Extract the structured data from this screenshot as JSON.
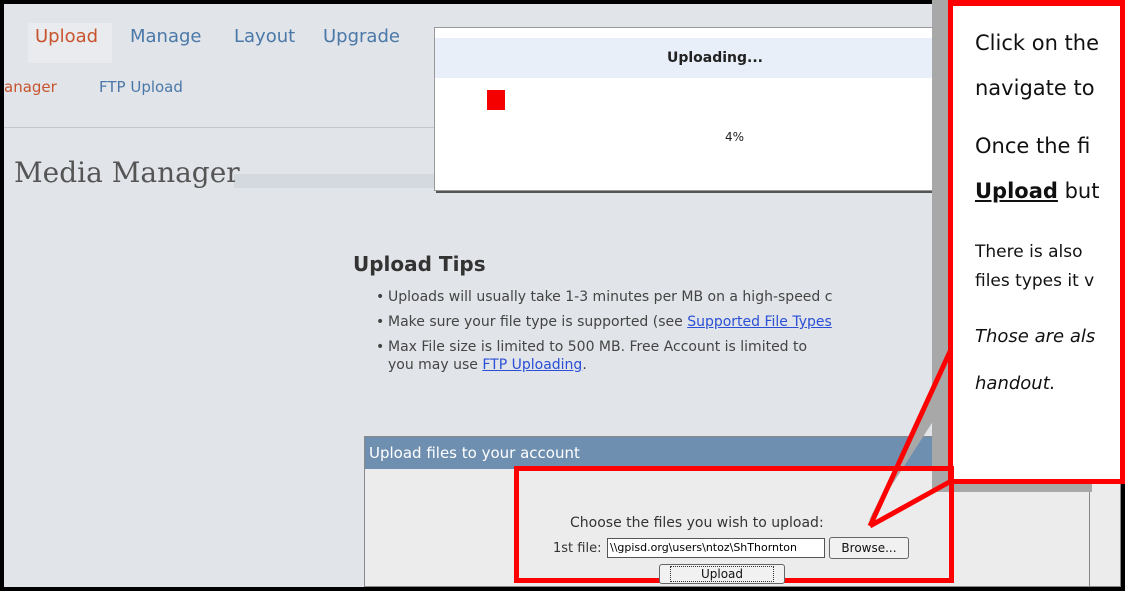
{
  "nav": {
    "tabs": [
      "Upload",
      "Manage",
      "Layout",
      "Upgrade"
    ],
    "subnav": [
      "anager",
      "FTP Upload"
    ]
  },
  "page_title": "Media Manager",
  "upload_tips": {
    "title": "Upload Tips",
    "items": [
      {
        "text": "Uploads will usually take 1-3 minutes per MB on a high-speed c"
      },
      {
        "text": "Make sure your file type is supported (see ",
        "link": "Supported File Types"
      },
      {
        "text": "Max File size is limited to 500 MB. Free Account is limited to ",
        "line2_text": "you may use ",
        "link": "FTP Uploading",
        "tail": "."
      }
    ]
  },
  "dialog": {
    "title": "Uploading...",
    "progress_percent": 4,
    "progress_label": "4%"
  },
  "panel": {
    "header": "Upload files to your account",
    "choose_text": "Choose the files you wish to upload:",
    "file_label": "1st file:",
    "file_value": "\\\\gpisd.org\\users\\ntoz\\ShThornton",
    "browse_label": "Browse...",
    "upload_label": "Upload"
  },
  "callout": {
    "line1": "Click on the",
    "line2": "navigate to",
    "line3": "Once the fi",
    "line4_bold": "Upload",
    "line4_tail": " but",
    "line5": "There is also",
    "line6": "files types it v",
    "line7": "Those are als",
    "line8": "handout."
  },
  "colors": {
    "accent_tab": "#c8542e",
    "link_tab": "#4a78a8",
    "callout_border": "#ff0000",
    "panel_header": "#6f8fb0"
  }
}
